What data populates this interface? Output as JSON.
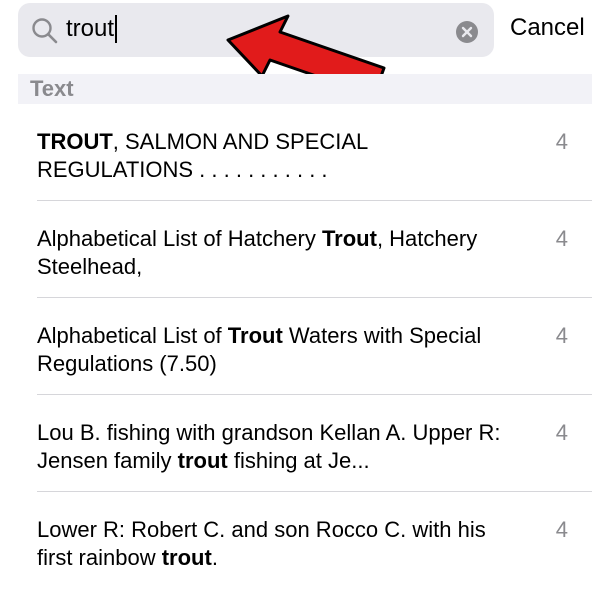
{
  "search": {
    "query": "trout",
    "cancel_label": "Cancel",
    "search_icon": "magnifying-glass-icon",
    "clear_icon": "clear-circle-icon"
  },
  "annotation": {
    "arrow_color": "#e11b1b",
    "arrow_icon": "red-arrow-pointing-at-search-field"
  },
  "results": {
    "section_title": "Text",
    "items": [
      {
        "parts": [
          {
            "text": "TROUT",
            "bold": true
          },
          {
            "text": ", SALMON AND SPECIAL REGULATIONS . . . . . . . . . . .",
            "bold": false
          }
        ],
        "count": "4"
      },
      {
        "parts": [
          {
            "text": "Alphabetical List of Hatchery ",
            "bold": false
          },
          {
            "text": "Trout",
            "bold": true
          },
          {
            "text": ", Hatchery Steelhead,",
            "bold": false
          }
        ],
        "count": "4"
      },
      {
        "parts": [
          {
            "text": "Alphabetical List of ",
            "bold": false
          },
          {
            "text": "Trout",
            "bold": true
          },
          {
            "text": " Waters with Special Regulations (7.50)",
            "bold": false
          }
        ],
        "count": "4"
      },
      {
        "parts": [
          {
            "text": "Lou B. fishing with grandson Kellan A. Upper R: Jensen family ",
            "bold": false
          },
          {
            "text": "trout",
            "bold": true
          },
          {
            "text": " fishing at Je...",
            "bold": false
          }
        ],
        "count": "4"
      },
      {
        "parts": [
          {
            "text": "Lower R: Robert C. and son Rocco C. with his first rainbow ",
            "bold": false
          },
          {
            "text": "trout",
            "bold": true
          },
          {
            "text": ".",
            "bold": false
          }
        ],
        "count": "4"
      }
    ]
  }
}
